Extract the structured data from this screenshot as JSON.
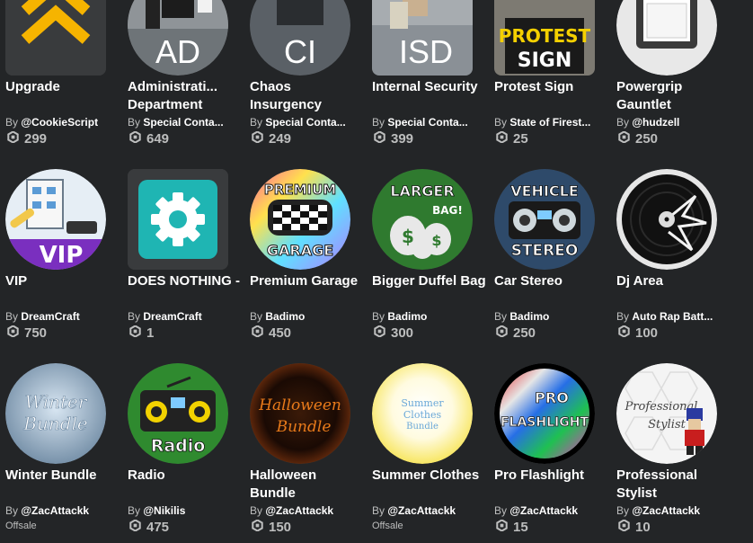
{
  "items": [
    {
      "name": "Upgrade",
      "by": "By",
      "creator": "@CookieScript",
      "price": "299"
    },
    {
      "name": "Administrati... Department",
      "by": "By",
      "creator": "Special Conta...",
      "price": "649",
      "thumb_text": "AD"
    },
    {
      "name": "Chaos Insurgency",
      "by": "By",
      "creator": "Special Conta...",
      "price": "249",
      "thumb_text": "CI"
    },
    {
      "name": "Internal Security",
      "by": "By",
      "creator": "Special Conta...",
      "price": "399",
      "thumb_text": "ISD"
    },
    {
      "name": "Protest Sign",
      "by": "By",
      "creator": "State of Firest...",
      "price": "25",
      "thumb_text": [
        "PROTEST",
        "SIGN"
      ]
    },
    {
      "name": "Powergrip Gauntlet",
      "by": "By",
      "creator": "@hudzell",
      "price": "250"
    },
    {
      "name": "VIP",
      "by": "By",
      "creator": "DreamCraft",
      "price": "750",
      "thumb_text": "VIP"
    },
    {
      "name": "DOES NOTHING -",
      "by": "By",
      "creator": "DreamCraft",
      "price": "1"
    },
    {
      "name": "Premium Garage",
      "by": "By",
      "creator": "Badimo",
      "price": "450",
      "thumb_text": [
        "PREMIUM",
        "GARAGE"
      ]
    },
    {
      "name": "Bigger Duffel Bag",
      "by": "By",
      "creator": "Badimo",
      "price": "300",
      "thumb_text": [
        "LARGER",
        "BAG!"
      ]
    },
    {
      "name": "Car Stereo",
      "by": "By",
      "creator": "Badimo",
      "price": "250",
      "thumb_text": [
        "VEHICLE",
        "STEREO"
      ]
    },
    {
      "name": "Dj Area",
      "by": "By",
      "creator": "Auto Rap Batt...",
      "price": "100"
    },
    {
      "name": "Winter Bundle",
      "by": "By",
      "creator": "@ZacAttackk",
      "offsale": "Offsale",
      "thumb_text": [
        "Winter",
        "Bundle"
      ]
    },
    {
      "name": "Radio",
      "by": "By",
      "creator": "@Nikilis",
      "price": "475",
      "thumb_text": "Radio"
    },
    {
      "name": "Halloween Bundle",
      "by": "By",
      "creator": "@ZacAttackk",
      "price": "150",
      "thumb_text": [
        "Halloween",
        "Bundle"
      ]
    },
    {
      "name": "Summer Clothes",
      "by": "By",
      "creator": "@ZacAttackk",
      "offsale": "Offsale",
      "thumb_text": [
        "Summer",
        "Clothes",
        "Bundle"
      ]
    },
    {
      "name": "Pro Flashlight",
      "by": "By",
      "creator": "@ZacAttackk",
      "price": "15",
      "thumb_text": [
        "PRO",
        "FLASHLIGHT"
      ]
    },
    {
      "name": "Professional Stylist",
      "by": "By",
      "creator": "@ZacAttackk",
      "price": "10",
      "thumb_text": [
        "Professional",
        "Stylist"
      ]
    }
  ],
  "colors": {
    "background": "#232527",
    "thumb_bg": "#393b3d",
    "secondary_text": "#bdbebe"
  },
  "icons": {
    "price": "robux-icon"
  }
}
